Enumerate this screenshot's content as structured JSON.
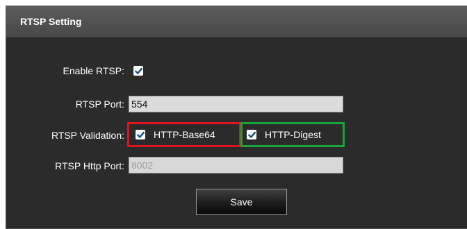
{
  "panel": {
    "title": "RTSP Setting"
  },
  "enable_rtsp": {
    "label": "Enable RTSP:",
    "checked": true
  },
  "rtsp_port": {
    "label": "RTSP Port:",
    "value": "554"
  },
  "rtsp_validation": {
    "label": "RTSP Validation:",
    "options": [
      {
        "label": "HTTP-Base64",
        "checked": true,
        "highlight": "#e0141e"
      },
      {
        "label": "HTTP-Digest",
        "checked": true,
        "highlight": "#19a53a"
      }
    ]
  },
  "rtsp_http_port": {
    "label": "RTSP Http Port:",
    "value": "8002",
    "disabled": true
  },
  "save_button": {
    "label": "Save"
  },
  "icons": {
    "checkbox": "checkmark-icon"
  }
}
